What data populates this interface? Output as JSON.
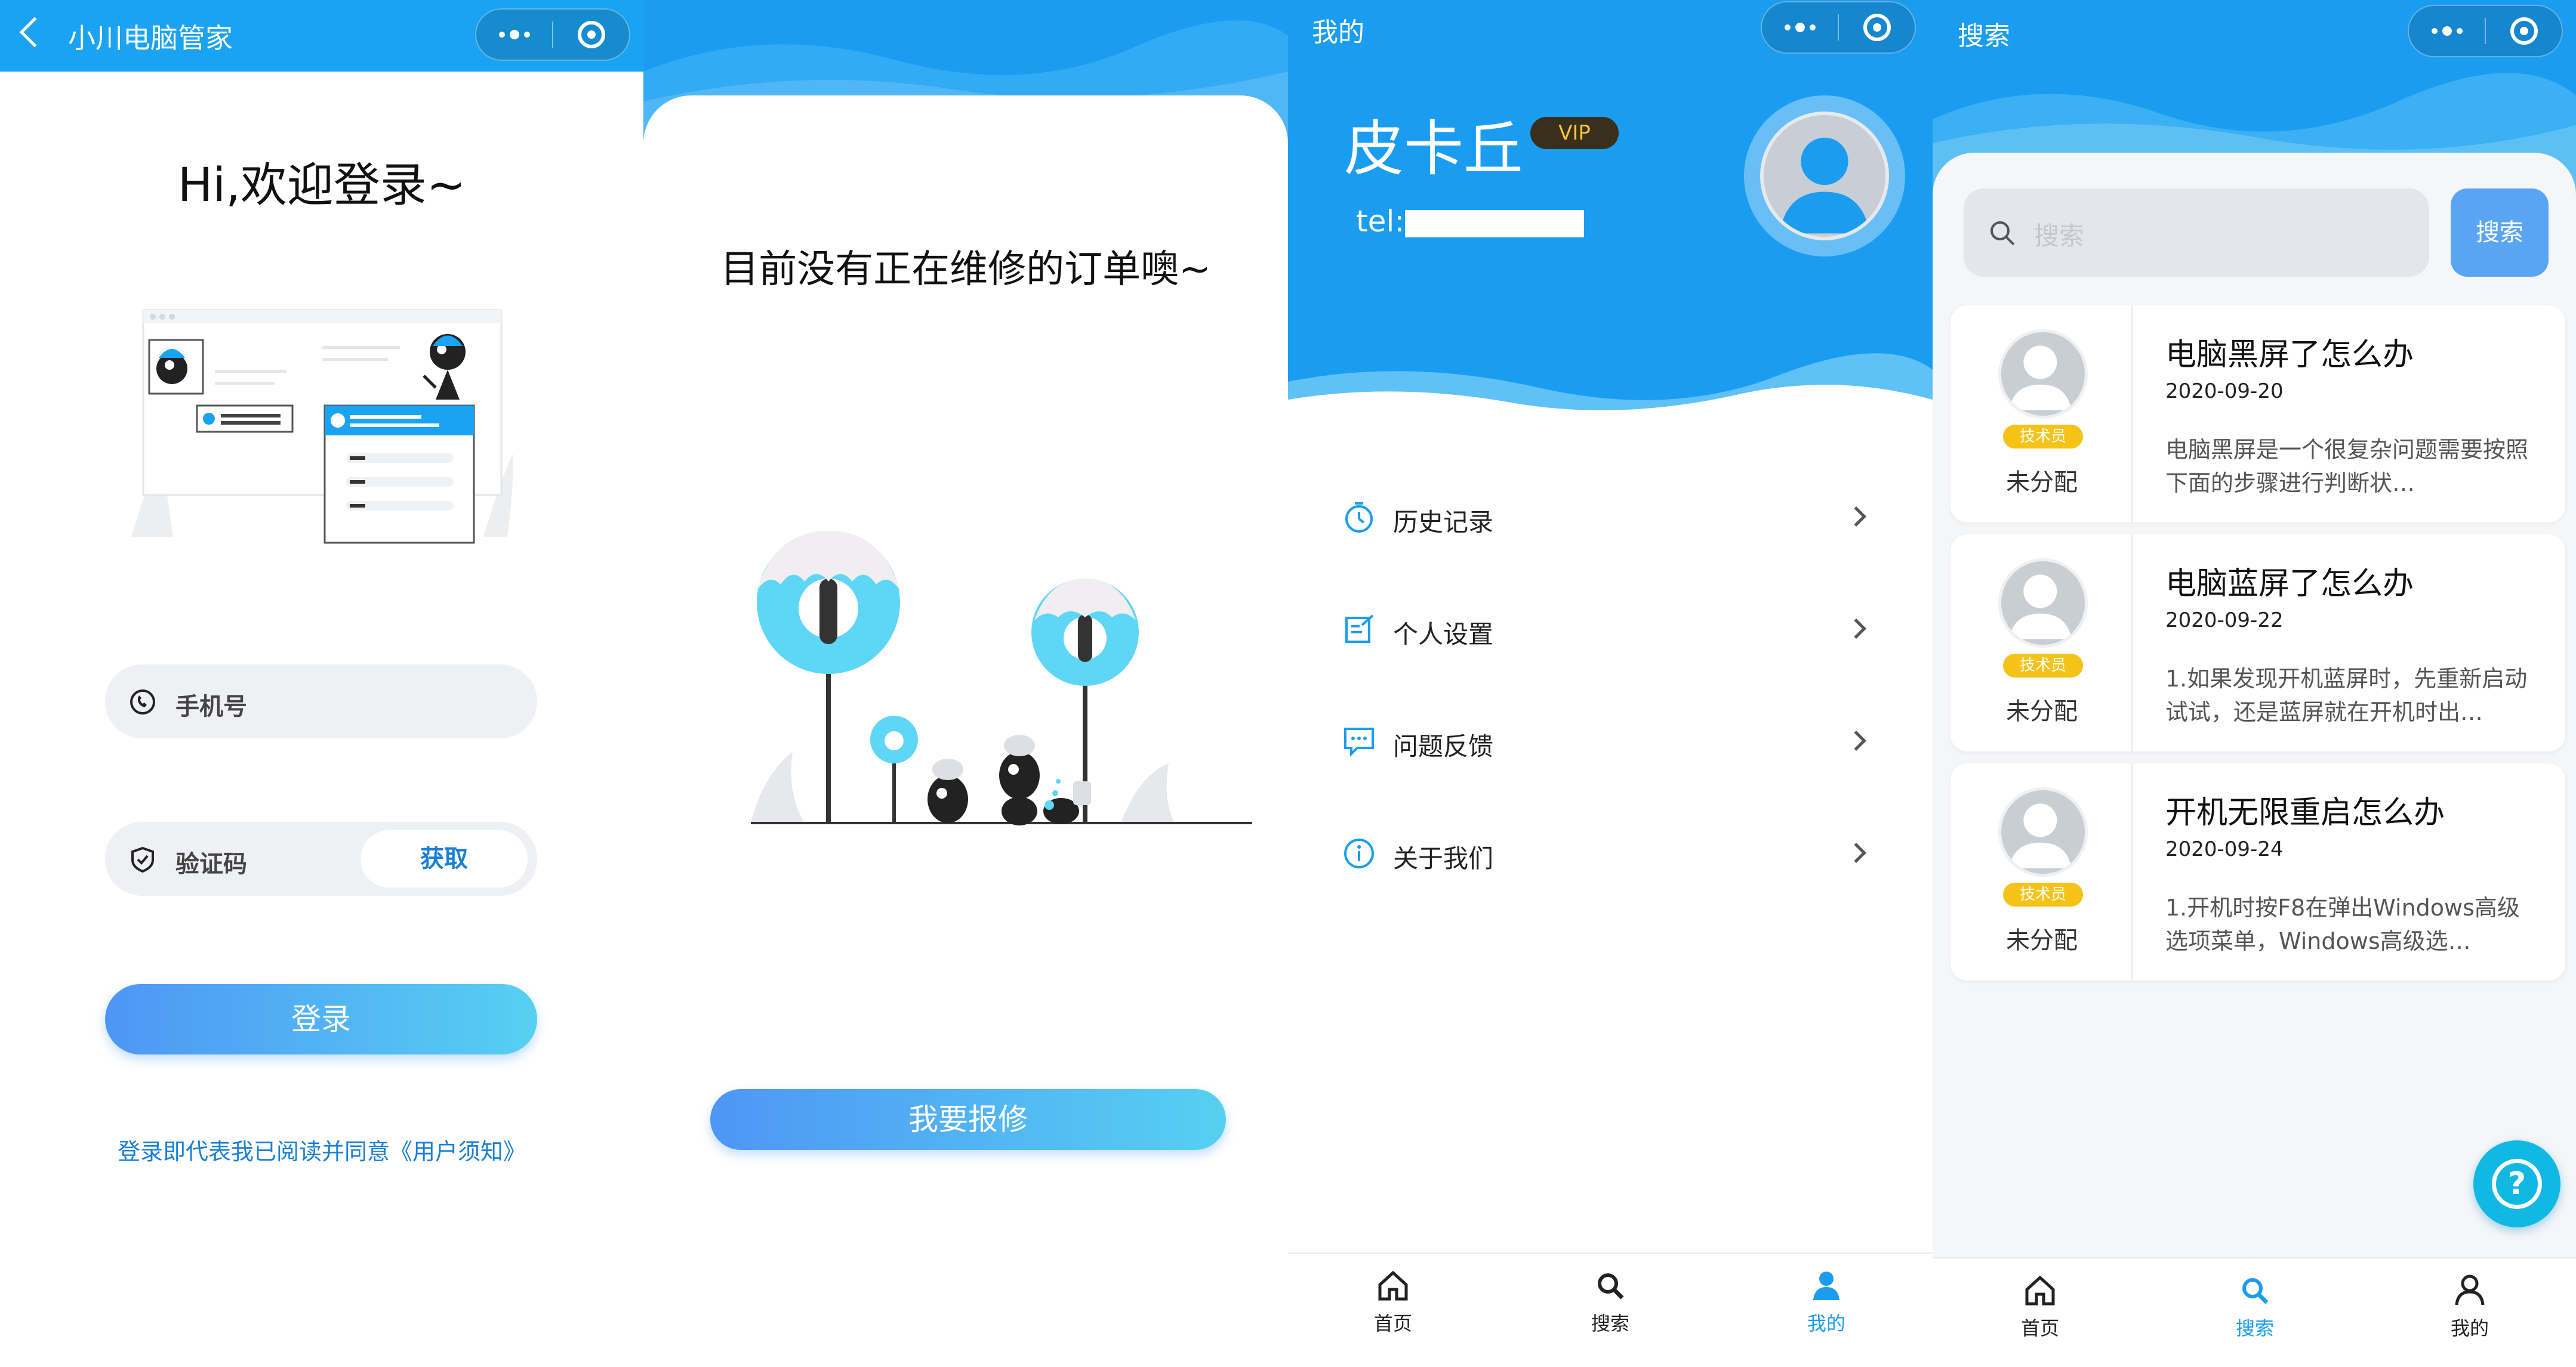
{
  "login": {
    "title": "小川电脑管家",
    "greeting": "Hi,欢迎登录~",
    "phone_label": "手机号",
    "code_label": "验证码",
    "code_button": "获取",
    "login_button": "登录",
    "agreement": "登录即代表我已阅读并同意《用户须知》"
  },
  "repair": {
    "message": "目前没有正在维修的订单噢~",
    "button": "我要报修"
  },
  "mine": {
    "header_title": "我的",
    "name": "皮卡丘",
    "vip_badge": "VIP",
    "tel_label": "tel:",
    "menu": [
      {
        "label": "历史记录",
        "icon": "stopwatch-icon"
      },
      {
        "label": "个人设置",
        "icon": "edit-note-icon"
      },
      {
        "label": "问题反馈",
        "icon": "chat-bubble-icon"
      },
      {
        "label": "关于我们",
        "icon": "info-icon"
      }
    ]
  },
  "search": {
    "header_title": "搜索",
    "placeholder": "搜索",
    "button": "搜索",
    "results": [
      {
        "title": "电脑黑屏了怎么办",
        "date": "2020-09-20",
        "desc": "电脑黑屏是一个很复杂问题需要按照下面的步骤进行判断状…",
        "badge": "技术员",
        "status": "未分配"
      },
      {
        "title": "电脑蓝屏了怎么办",
        "date": "2020-09-22",
        "desc": "1.如果发现开机蓝屏时，先重新启动试试，还是蓝屏就在开机时出…",
        "badge": "技术员",
        "status": "未分配"
      },
      {
        "title": "开机无限重启怎么办",
        "date": "2020-09-24",
        "desc": "1.开机时按F8在弹出Windows高级选项菜单，Windows高级选…",
        "badge": "技术员",
        "status": "未分配"
      }
    ]
  },
  "tabbar": {
    "home": "首页",
    "search": "搜索",
    "mine": "我的"
  },
  "colors": {
    "primary": "#1a9df0",
    "accent_gradient_start": "#4e96f5",
    "accent_gradient_end": "#56d0f2",
    "badge": "#f5c318",
    "vip_text": "#f5c542"
  }
}
